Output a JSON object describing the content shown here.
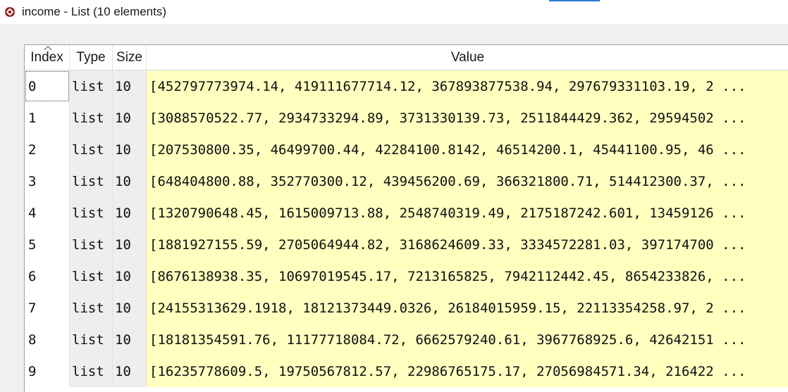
{
  "window": {
    "title": "income - List (10 elements)",
    "icon": "spyder-app-icon"
  },
  "table": {
    "columns": [
      "Index",
      "Type",
      "Size",
      "Value"
    ],
    "rows": [
      {
        "index": "0",
        "type": "list",
        "size": "10",
        "value": "[452797773974.14, 419111677714.12, 367893877538.94, 297679331103.19, 2 ..."
      },
      {
        "index": "1",
        "type": "list",
        "size": "10",
        "value": "[3088570522.77, 2934733294.89, 3731330139.73, 2511844429.362, 29594502 ..."
      },
      {
        "index": "2",
        "type": "list",
        "size": "10",
        "value": "[207530800.35, 46499700.44, 42284100.8142, 46514200.1, 45441100.95, 46 ..."
      },
      {
        "index": "3",
        "type": "list",
        "size": "10",
        "value": "[648404800.88, 352770300.12, 439456200.69, 366321800.71, 514412300.37, ..."
      },
      {
        "index": "4",
        "type": "list",
        "size": "10",
        "value": "[1320790648.45, 1615009713.88, 2548740319.49, 2175187242.601, 13459126 ..."
      },
      {
        "index": "5",
        "type": "list",
        "size": "10",
        "value": "[1881927155.59, 2705064944.82, 3168624609.33, 3334572281.03, 397174700 ..."
      },
      {
        "index": "6",
        "type": "list",
        "size": "10",
        "value": "[8676138938.35, 10697019545.17, 7213165825, 7942112442.45, 8654233826, ..."
      },
      {
        "index": "7",
        "type": "list",
        "size": "10",
        "value": "[24155313629.1918, 18121373449.0326, 26184015959.15, 22113354258.97, 2 ..."
      },
      {
        "index": "8",
        "type": "list",
        "size": "10",
        "value": "[18181354591.76, 11177718084.72, 6662579240.61, 3967768925.6, 42642151 ..."
      },
      {
        "index": "9",
        "type": "list",
        "size": "10",
        "value": "[16235778609.5, 19750567812.57, 22986765175.17, 27056984571.34, 216422 ..."
      }
    ]
  },
  "colors": {
    "value_background": "#ffffc0",
    "type_size_background": "#eeeeee",
    "accent": "#2a7bd4"
  }
}
